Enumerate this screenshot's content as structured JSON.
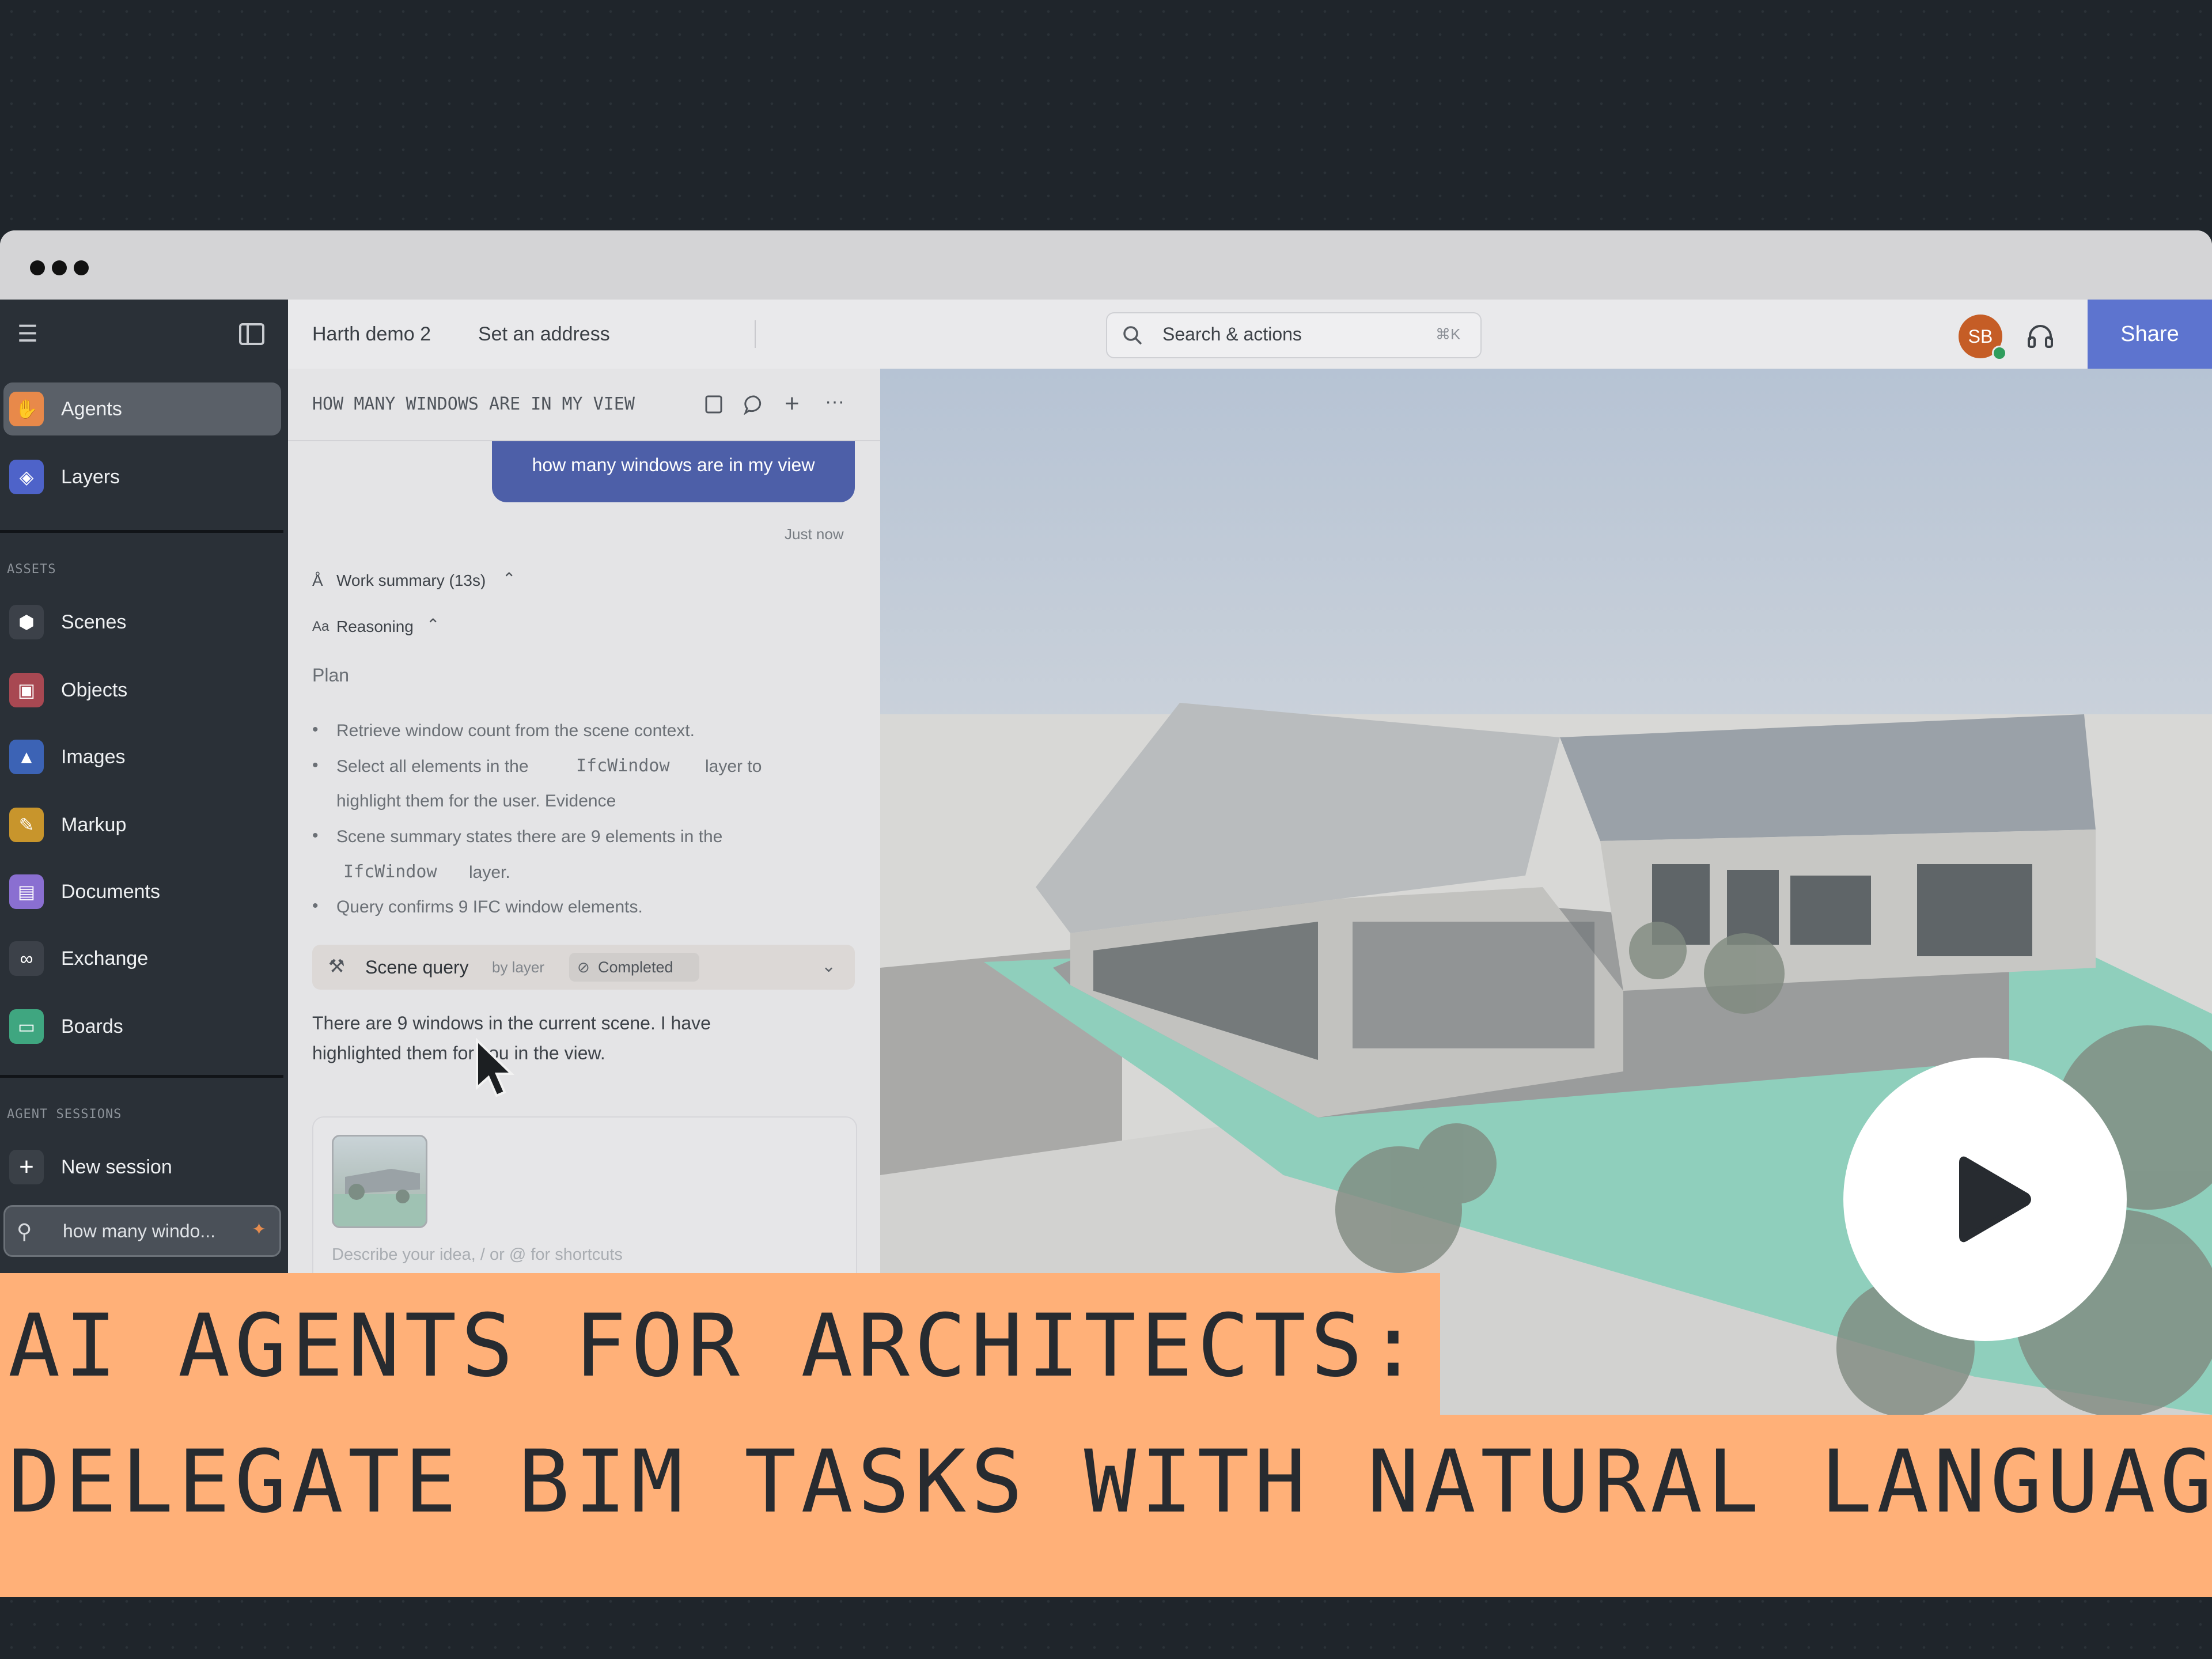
{
  "header": {
    "project_name": "Harth demo 2",
    "address": "Set an address",
    "search_placeholder": "Search & actions",
    "search_shortcut": "⌘K",
    "avatar_initials": "SB",
    "share_label": "Share"
  },
  "sidebar": {
    "nav": [
      {
        "label": "Agents",
        "icon": "agents-icon",
        "color": "#e8894a",
        "active": true
      },
      {
        "label": "Layers",
        "icon": "layers-icon",
        "color": "#4e63c9"
      }
    ],
    "assets_heading": "ASSETS",
    "assets": [
      {
        "label": "Scenes",
        "icon": "cube-icon",
        "color": "#3c4149"
      },
      {
        "label": "Objects",
        "icon": "chair-icon",
        "color": "#a84852"
      },
      {
        "label": "Images",
        "icon": "image-icon",
        "color": "#3c63b5"
      },
      {
        "label": "Markup",
        "icon": "markup-icon",
        "color": "#c8952c"
      },
      {
        "label": "Documents",
        "icon": "document-icon",
        "color": "#8a6fd1"
      },
      {
        "label": "Exchange",
        "icon": "link-icon",
        "color": "#3c4149"
      },
      {
        "label": "Boards",
        "icon": "board-icon",
        "color": "#3fa680"
      }
    ],
    "sessions_heading": "AGENT SESSIONS",
    "new_session": "New session",
    "current_session": "how many windo..."
  },
  "chat": {
    "title": "HOW MANY WINDOWS ARE IN MY VIEW",
    "user_message": "how many windows are in my view",
    "timestamp": "Just now",
    "work_summary": "Work summary (13s)",
    "reasoning": "Reasoning",
    "plan_heading": "Plan",
    "plan_lines": [
      "Retrieve window count from the scene context.",
      "Select all elements in the",
      "IfcWindow",
      "layer to",
      "highlight them for the user. Evidence",
      "Scene summary states there are 9 elements in the",
      "IfcWindow",
      "layer.",
      "Query confirms 9 IFC window elements."
    ],
    "tool": {
      "name": "Scene query",
      "sub": "by layer",
      "status": "Completed"
    },
    "answer_line1": "There are 9 windows in the current scene. I have",
    "answer_line2": "highlighted them for you in the view.",
    "input_placeholder": "Describe your idea, / or @ for shortcuts"
  },
  "banner": {
    "line1": "AI AGENTS FOR ARCHITECTS:",
    "line2": "DELEGATE BIM TASKS WITH NATURAL LANGUAGE"
  }
}
